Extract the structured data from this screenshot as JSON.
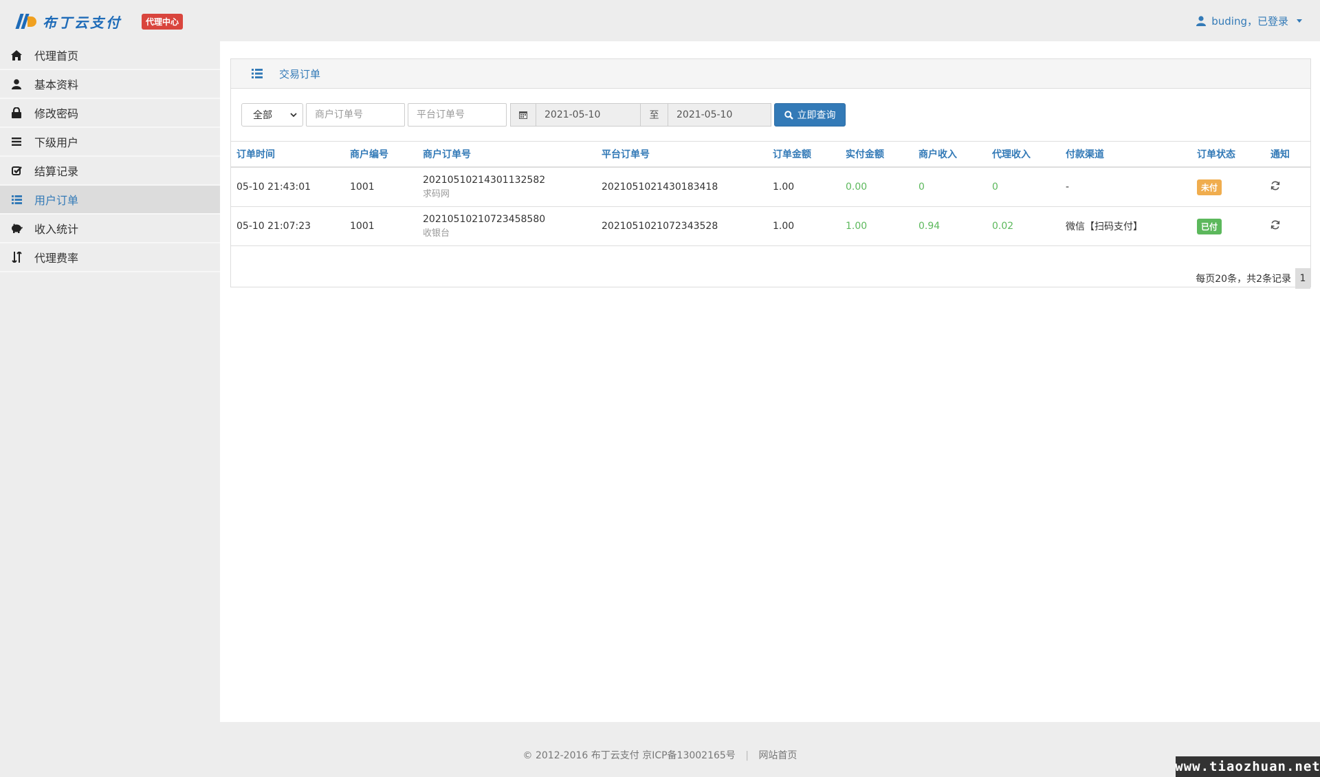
{
  "header": {
    "logo_text": "布丁云支付",
    "badge": "代理中心",
    "user_text": "buding，已登录"
  },
  "sidebar": {
    "items": [
      {
        "label": "代理首页",
        "icon": "home-icon"
      },
      {
        "label": "基本资料",
        "icon": "user-icon"
      },
      {
        "label": "修改密码",
        "icon": "lock-icon"
      },
      {
        "label": "下级用户",
        "icon": "menu-icon"
      },
      {
        "label": "结算记录",
        "icon": "check-square-icon"
      },
      {
        "label": "用户订单",
        "icon": "list-icon",
        "active": true
      },
      {
        "label": "收入统计",
        "icon": "piggy-bank-icon"
      },
      {
        "label": "代理费率",
        "icon": "sort-arrows-icon"
      }
    ]
  },
  "panel": {
    "title": "交易订单"
  },
  "filters": {
    "type_selected": "全部",
    "merchant_order_placeholder": "商户订单号",
    "platform_order_placeholder": "平台订单号",
    "date_from": "2021-05-10",
    "to_label": "至",
    "date_to": "2021-05-10",
    "query_button": "立即查询"
  },
  "table": {
    "headers": [
      "订单时间",
      "商户编号",
      "商户订单号",
      "平台订单号",
      "订单金额",
      "实付金额",
      "商户收入",
      "代理收入",
      "付款渠道",
      "订单状态",
      "通知"
    ],
    "rows": [
      {
        "time": "05-10 21:43:01",
        "merchant_id": "1001",
        "merchant_order": "20210510214301132582",
        "merchant_order_sub": "求码网",
        "platform_order": "2021051021430183418",
        "amount": "1.00",
        "paid": "0.00",
        "merchant_income": "0",
        "agent_income": "0",
        "channel": "-",
        "status": "未付",
        "status_color": "#f0ad4e"
      },
      {
        "time": "05-10 21:07:23",
        "merchant_id": "1001",
        "merchant_order": "20210510210723458580",
        "merchant_order_sub": "收银台",
        "platform_order": "2021051021072343528",
        "amount": "1.00",
        "paid": "1.00",
        "merchant_income": "0.94",
        "agent_income": "0.02",
        "channel": "微信【扫码支付】",
        "status": "已付",
        "status_color": "#5cb85c"
      }
    ]
  },
  "pager": {
    "summary": "每页20条，共2条记录",
    "current_page": "1"
  },
  "footer": {
    "copyright": "© 2012-2016  布丁云支付  京ICP备13002165号",
    "separator": "|",
    "home_link": "网站首页"
  },
  "watermark": "www.tiaozhuan.net",
  "colors": {
    "primary": "#337ab7",
    "danger": "#d9453d",
    "success": "#5cb85c",
    "warning": "#f0ad4e"
  }
}
